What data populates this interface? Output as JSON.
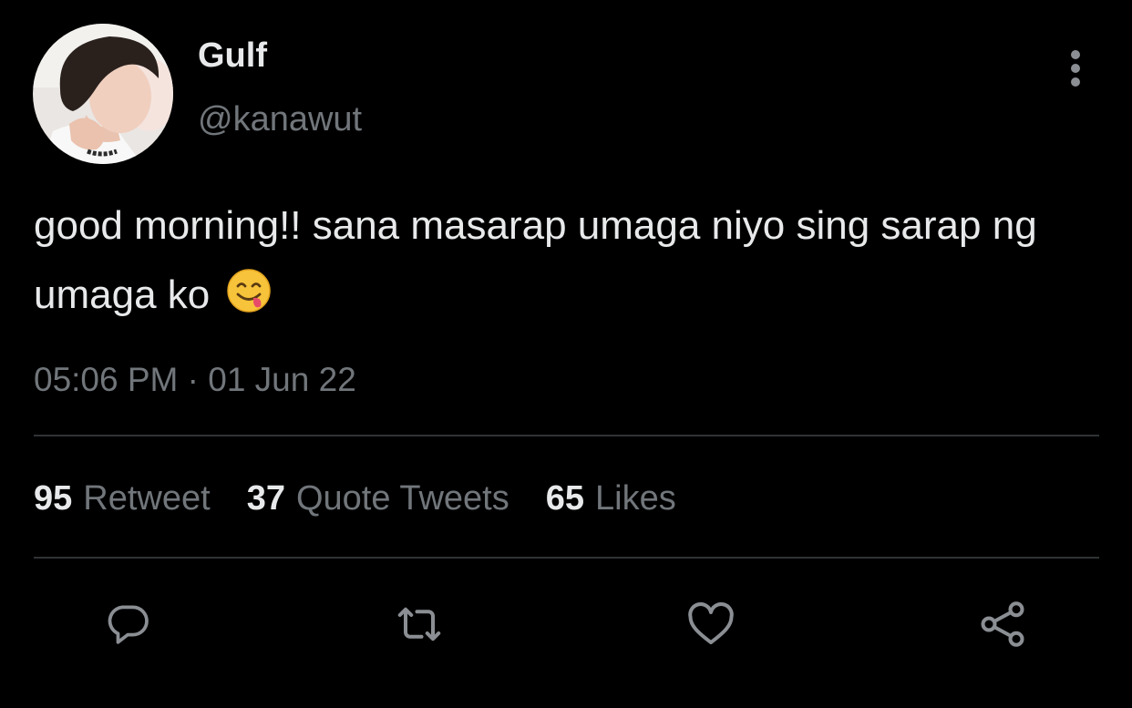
{
  "author": {
    "display_name": "Gulf",
    "handle": "@kanawut"
  },
  "tweet": {
    "text": "good morning!! sana masarap umaga niyo sing sarap ng umaga ko",
    "emoji": "face-savoring-food",
    "timestamp": "05:06 PM · 01 Jun 22"
  },
  "stats": [
    {
      "count": "95",
      "label": "Retweet"
    },
    {
      "count": "37",
      "label": "Quote Tweets"
    },
    {
      "count": "65",
      "label": "Likes"
    }
  ],
  "actions": [
    "reply-icon",
    "retweet-icon",
    "like-icon",
    "share-icon"
  ],
  "colors": {
    "background": "#000000",
    "primary_text": "#e7e9ea",
    "secondary_text": "#71767b",
    "divider": "#2f3336"
  }
}
